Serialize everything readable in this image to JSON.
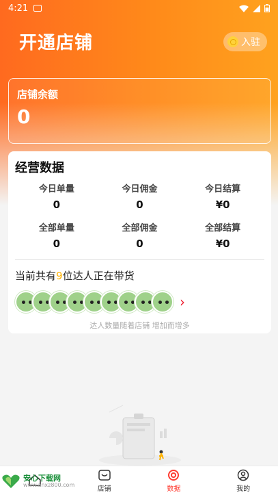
{
  "status_bar": {
    "time": "4:21"
  },
  "header": {
    "title": "开通店铺",
    "join_label": "入驻"
  },
  "balance": {
    "label": "店铺余额",
    "value": "0"
  },
  "business": {
    "title": "经营数据",
    "stats": [
      {
        "label": "今日单量",
        "value": "0"
      },
      {
        "label": "今日佣金",
        "value": "0"
      },
      {
        "label": "今日结算",
        "value": "¥0"
      },
      {
        "label": "全部单量",
        "value": "0"
      },
      {
        "label": "全部佣金",
        "value": "0"
      },
      {
        "label": "全部结算",
        "value": "¥0"
      }
    ],
    "talent_prefix": "当前共有",
    "talent_count": "9",
    "talent_suffix": "位达人正在带货",
    "avatar_hint": "达人数量随着店铺 增加而增多"
  },
  "watermark": {
    "title": "安心下载网",
    "url": "www.anxz800.com"
  },
  "tabbar": {
    "items": [
      {
        "label": "",
        "icon": "home-icon",
        "active": false
      },
      {
        "label": "店铺",
        "icon": "shop-icon",
        "active": false
      },
      {
        "label": "数据",
        "icon": "data-icon",
        "active": true
      },
      {
        "label": "我的",
        "icon": "user-icon",
        "active": false
      }
    ]
  },
  "colors": {
    "accent": "#ff6a1f",
    "active_tab": "#ff3b30",
    "highlight": "#ffb300"
  }
}
